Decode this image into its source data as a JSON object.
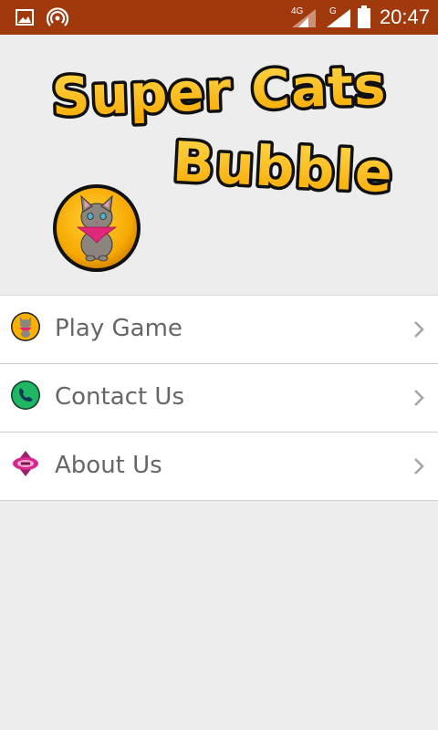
{
  "status_bar": {
    "time": "20:47",
    "network_tag_1": "4G",
    "network_tag_2": "G",
    "icons": [
      "gallery-icon",
      "hotspot-icon",
      "signal-4g-icon",
      "signal-g-icon",
      "battery-icon"
    ],
    "background_color": "#a0390c"
  },
  "header": {
    "logo_line_1": "Super Cats",
    "logo_line_2": "Bubble",
    "logo_fill_color": "#ffc21a",
    "logo_outline_color": "#111111"
  },
  "menu": {
    "items": [
      {
        "label": "Play Game",
        "icon": "cat-icon"
      },
      {
        "label": "Contact Us",
        "icon": "phone-icon"
      },
      {
        "label": "About Us",
        "icon": "badge-icon"
      }
    ],
    "chevron_icon": "chevron-right-icon",
    "label_color": "#666666"
  }
}
